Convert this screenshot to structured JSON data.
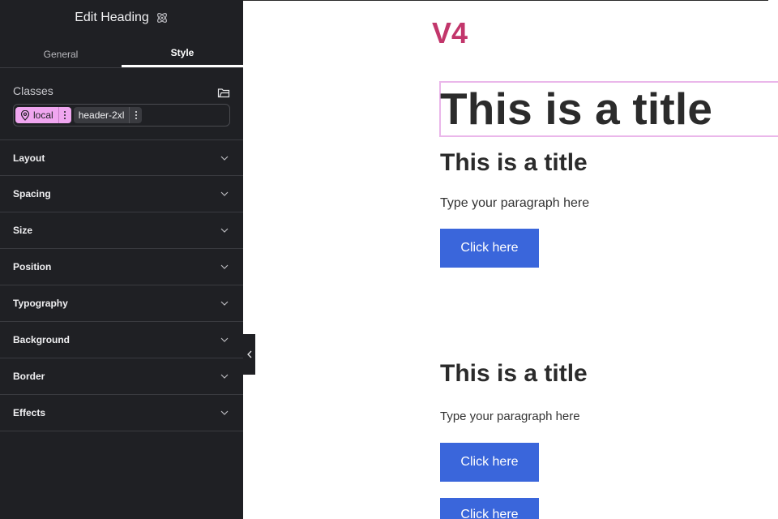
{
  "panel": {
    "title": "Edit Heading",
    "tabs": [
      {
        "label": "General",
        "active": false
      },
      {
        "label": "Style",
        "active": true
      }
    ],
    "classes": {
      "label": "Classes",
      "chips": [
        {
          "label": "local",
          "color": "#f0a6f0"
        },
        {
          "label": "header-2xl",
          "color": "#3a3b40"
        }
      ]
    },
    "sections": [
      "Layout",
      "Spacing",
      "Size",
      "Position",
      "Typography",
      "Background",
      "Border",
      "Effects"
    ]
  },
  "canvas": {
    "version_label": "V4",
    "version_color": "#c2366b",
    "selected_heading": "This is a title",
    "block_1": {
      "heading": "This is a title",
      "paragraph": "Type your paragraph here",
      "button": "Click here"
    },
    "block_2": {
      "heading": "This is a title",
      "paragraph": "Type your paragraph here",
      "button": "Click here"
    },
    "extra_button": "Click here",
    "accent_color": "#3a66db",
    "selection_color": "#eab7ea"
  }
}
